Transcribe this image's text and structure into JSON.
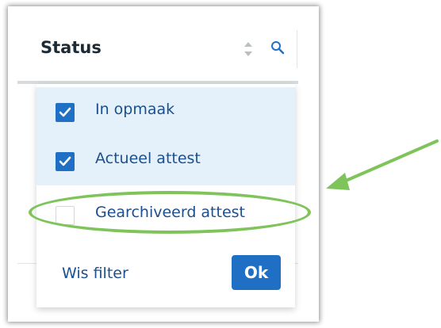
{
  "column": {
    "title": "Status",
    "sort_icon": "sort-updown-icon",
    "search_icon": "search-icon"
  },
  "filter": {
    "options": [
      {
        "label": "In opmaak",
        "checked": true
      },
      {
        "label": "Actueel attest",
        "checked": true
      },
      {
        "label": "Gearchiveerd attest",
        "checked": false
      }
    ],
    "clear_label": "Wis filter",
    "ok_label": "Ok"
  },
  "colors": {
    "primary": "#1f6fc5",
    "link": "#1b4f8f",
    "selected_row": "#e4f1fb",
    "annotation": "#7fc45b"
  },
  "annotation": {
    "highlighted_option": "Gearchiveerd attest"
  }
}
